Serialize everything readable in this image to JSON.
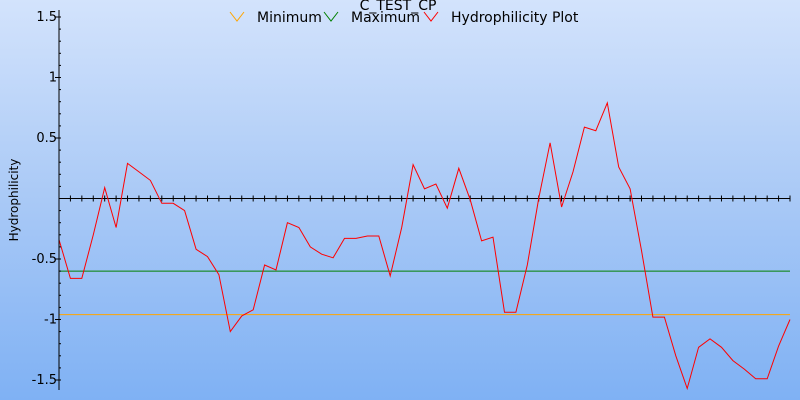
{
  "chart_data": {
    "type": "line",
    "title": "C_TEST_CP",
    "ylabel": "Hydrophilicity",
    "xlabel": "",
    "ylim": [
      -1.58,
      1.58
    ],
    "yticks": [
      {
        "value": 1.5,
        "label": "1.5"
      },
      {
        "value": 1,
        "label": "1"
      },
      {
        "value": 0.5,
        "label": "0.5"
      },
      {
        "value": -0.5,
        "label": "-0.5"
      },
      {
        "value": -1,
        "label": "-1"
      },
      {
        "value": -1.5,
        "label": "-1.5"
      }
    ],
    "baseline": 0,
    "x_count": 65,
    "grid": false,
    "legend_placement": "top",
    "series": [
      {
        "name": "Minimum",
        "color": "#ffa500",
        "constant": -0.96
      },
      {
        "name": "Maximum",
        "color": "#008000",
        "constant": -0.6
      },
      {
        "name": "Hydrophilicity Plot",
        "color": "#ff0000",
        "values": [
          -0.34,
          -0.66,
          -0.66,
          -0.3,
          0.09,
          -0.24,
          0.29,
          0.22,
          0.15,
          -0.04,
          -0.04,
          -0.1,
          -0.42,
          -0.48,
          -0.63,
          -1.1,
          -0.97,
          -0.92,
          -0.55,
          -0.59,
          -0.2,
          -0.24,
          -0.4,
          -0.46,
          -0.49,
          -0.33,
          -0.33,
          -0.31,
          -0.31,
          -0.64,
          -0.24,
          0.28,
          0.08,
          0.12,
          -0.08,
          0.25,
          -0.01,
          -0.35,
          -0.32,
          -0.94,
          -0.94,
          -0.55,
          0.0,
          0.46,
          -0.07,
          0.22,
          0.59,
          0.56,
          0.79,
          0.26,
          0.08,
          -0.43,
          -0.98,
          -0.98,
          -1.3,
          -1.57,
          -1.23,
          -1.16,
          -1.23,
          -1.34,
          -1.41,
          -1.49,
          -1.49,
          -1.22,
          -1.0
        ]
      }
    ]
  }
}
